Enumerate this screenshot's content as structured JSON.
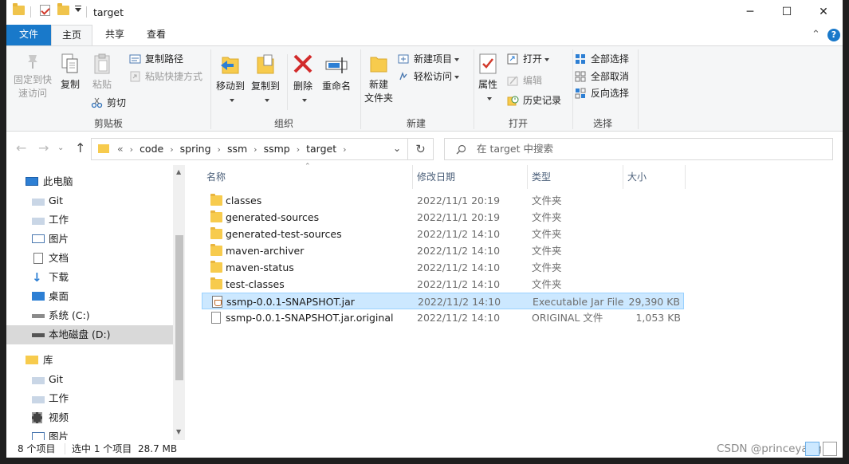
{
  "window": {
    "title": "target",
    "controls": {
      "minimize": "─",
      "maximize": "☐",
      "close": "✕"
    }
  },
  "tabs": [
    {
      "label": "文件"
    },
    {
      "label": "主页"
    },
    {
      "label": "共享"
    },
    {
      "label": "查看"
    }
  ],
  "help_label": "?",
  "ribbon": {
    "clipboard": {
      "label": "剪贴板",
      "pin_line1": "固定到快",
      "pin_line2": "速访问",
      "copy": "复制",
      "paste": "粘贴",
      "copy_path": "复制路径",
      "paste_shortcut": "粘贴快捷方式",
      "cut": "剪切"
    },
    "organize": {
      "label": "组织",
      "move_to": "移动到",
      "copy_to": "复制到",
      "delete": "删除",
      "rename": "重命名"
    },
    "new": {
      "label": "新建",
      "new_folder_line1": "新建",
      "new_folder_line2": "文件夹",
      "new_item": "新建项目",
      "easy_access": "轻松访问"
    },
    "open": {
      "label": "打开",
      "properties": "属性",
      "open": "打开",
      "edit": "编辑",
      "history": "历史记录"
    },
    "select": {
      "label": "选择",
      "select_all": "全部选择",
      "select_none": "全部取消",
      "invert": "反向选择"
    }
  },
  "address": {
    "prefix": "«",
    "crumbs": [
      "code",
      "spring",
      "ssm",
      "ssmp",
      "target"
    ],
    "search_placeholder": "在 target 中搜索"
  },
  "nav": {
    "items": [
      {
        "label": "此电脑"
      },
      {
        "label": "Git"
      },
      {
        "label": "工作"
      },
      {
        "label": "图片"
      },
      {
        "label": "文档"
      },
      {
        "label": "下载"
      },
      {
        "label": "桌面"
      },
      {
        "label": "系统 (C:)"
      },
      {
        "label": "本地磁盘 (D:)"
      },
      {
        "label": "库"
      },
      {
        "label": "Git"
      },
      {
        "label": "工作"
      },
      {
        "label": "视频"
      },
      {
        "label": "图片"
      }
    ]
  },
  "columns": {
    "name": "名称",
    "date": "修改日期",
    "type": "类型",
    "size": "大小"
  },
  "files": [
    {
      "name": "classes",
      "date": "2022/11/1 20:19",
      "type": "文件夹",
      "size": "",
      "kind": "folder"
    },
    {
      "name": "generated-sources",
      "date": "2022/11/1 20:19",
      "type": "文件夹",
      "size": "",
      "kind": "folder"
    },
    {
      "name": "generated-test-sources",
      "date": "2022/11/2 14:10",
      "type": "文件夹",
      "size": "",
      "kind": "folder"
    },
    {
      "name": "maven-archiver",
      "date": "2022/11/2 14:10",
      "type": "文件夹",
      "size": "",
      "kind": "folder"
    },
    {
      "name": "maven-status",
      "date": "2022/11/2 14:10",
      "type": "文件夹",
      "size": "",
      "kind": "folder"
    },
    {
      "name": "test-classes",
      "date": "2022/11/2 14:10",
      "type": "文件夹",
      "size": "",
      "kind": "folder"
    },
    {
      "name": "ssmp-0.0.1-SNAPSHOT.jar",
      "date": "2022/11/2 14:10",
      "type": "Executable Jar File",
      "size": "29,390 KB",
      "kind": "jar"
    },
    {
      "name": "ssmp-0.0.1-SNAPSHOT.jar.original",
      "date": "2022/11/2 14:10",
      "type": "ORIGINAL 文件",
      "size": "1,053 KB",
      "kind": "doc"
    }
  ],
  "status": {
    "count": "8 个项目",
    "selected": "选中 1 个项目",
    "size": "28.7 MB",
    "watermark": "CSDN @princeyang"
  },
  "colors": {
    "accent": "#1979ca",
    "selection": "#cce8ff",
    "folder": "#f7cb4d"
  }
}
